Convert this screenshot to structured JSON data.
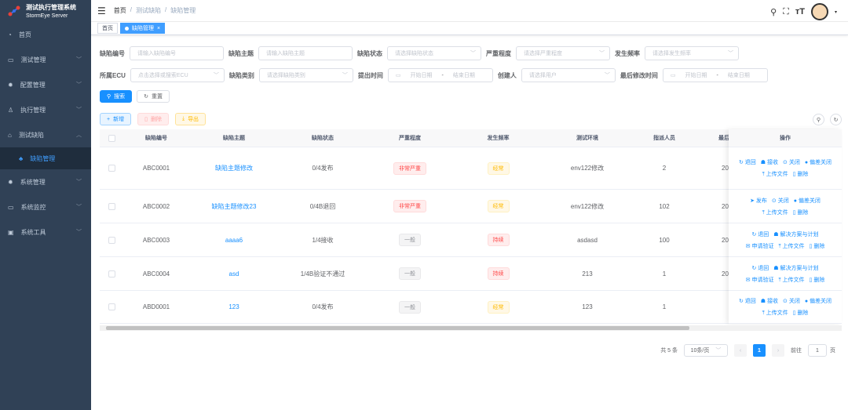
{
  "app": {
    "title": "测试执行管理系统",
    "subtitle": "StormEye Server"
  },
  "sidebar": {
    "items": [
      {
        "label": "首页",
        "icon": "dashboard-icon"
      },
      {
        "label": "测试管理",
        "icon": "monitor-icon",
        "arrow": "﹀"
      },
      {
        "label": "配置管理",
        "icon": "gear-icon",
        "arrow": "﹀"
      },
      {
        "label": "执行管理",
        "icon": "person-icon",
        "arrow": "﹀"
      },
      {
        "label": "测试缺陷",
        "icon": "bug-icon",
        "arrow": "︿"
      },
      {
        "label": "缺陷管理",
        "icon": "tree-icon"
      },
      {
        "label": "系统管理",
        "icon": "gear-icon",
        "arrow": "﹀"
      },
      {
        "label": "系统监控",
        "icon": "monitor-icon",
        "arrow": "﹀"
      },
      {
        "label": "系统工具",
        "icon": "toolbox-icon",
        "arrow": "﹀"
      }
    ]
  },
  "breadcrumb": [
    "首页",
    "测试缺陷",
    "缺陷管理"
  ],
  "tags": [
    {
      "label": "首页"
    },
    {
      "label": "缺陷管理",
      "close": "×"
    }
  ],
  "form": {
    "defect_no": {
      "label": "缺陷编号",
      "placeholder": "请输入缺陷编号"
    },
    "subject": {
      "label": "缺陷主题",
      "placeholder": "请输入缺陷主题"
    },
    "status": {
      "label": "缺陷状态",
      "placeholder": "请选择缺陷状态"
    },
    "severity": {
      "label": "严重程度",
      "placeholder": "请选择严重程度"
    },
    "frequency": {
      "label": "发生频率",
      "placeholder": "请选择发生频率"
    },
    "ecu": {
      "label": "所属ECU",
      "placeholder": "点击选择或搜索ECU"
    },
    "category": {
      "label": "缺陷类别",
      "placeholder": "请选择缺陷类别"
    },
    "submit_time": {
      "label": "提出时间",
      "start": "开始日期",
      "sep": "-",
      "end": "结束日期"
    },
    "creator": {
      "label": "创建人",
      "placeholder": "请选择用户"
    },
    "modified_time": {
      "label": "最后修改时间",
      "start": "开始日期",
      "sep": "-",
      "end": "结束日期"
    },
    "search": "搜索",
    "reset": "重置"
  },
  "toolbar": {
    "add": "新增",
    "delete": "删除",
    "export": "导出"
  },
  "table": {
    "headers": [
      "缺陷编号",
      "缺陷主题",
      "缺陷状态",
      "严重程度",
      "发生频率",
      "测试环境",
      "指派人员",
      "最后"
    ],
    "ops_header": "操作",
    "rows": [
      {
        "id": "ABC0001",
        "subject": "缺陷主题修改",
        "status": "0/4发布",
        "severity": "非常严重",
        "sev_type": "danger",
        "freq": "经常",
        "freq_type": "warn",
        "env": "env122修改",
        "assignee": "2",
        "last": "20",
        "ops": [
          [
            "退回",
            "接收",
            "关闭",
            "偏差关闭"
          ],
          [
            "上传文件",
            "删除"
          ]
        ]
      },
      {
        "id": "ABC0002",
        "subject": "缺陷主题修改23",
        "status": "0/4B退回",
        "severity": "非常严重",
        "sev_type": "danger",
        "freq": "经常",
        "freq_type": "warn",
        "env": "env122修改",
        "assignee": "102",
        "last": "20",
        "ops": [
          [
            "发布",
            "关闭",
            "偏差关闭"
          ],
          [
            "上传文件",
            "删除"
          ]
        ]
      },
      {
        "id": "ABC0003",
        "subject": "aaaa6",
        "status": "1/4接收",
        "severity": "一般",
        "sev_type": "info",
        "freq": "持续",
        "freq_type": "danger",
        "env": "asdasd",
        "assignee": "100",
        "last": "20",
        "ops": [
          [
            "退回",
            "解决方案与计划"
          ],
          [
            "申请验证",
            "上传文件",
            "删除"
          ]
        ]
      },
      {
        "id": "ABC0004",
        "subject": "asd",
        "status": "1/4B验证不通过",
        "severity": "一般",
        "sev_type": "info",
        "freq": "持续",
        "freq_type": "danger",
        "env": "213",
        "assignee": "1",
        "last": "20",
        "ops": [
          [
            "退回",
            "解决方案与计划"
          ],
          [
            "申请验证",
            "上传文件",
            "删除"
          ]
        ]
      },
      {
        "id": "ABD0001",
        "subject": "123",
        "status": "0/4发布",
        "severity": "一般",
        "sev_type": "info",
        "freq": "经常",
        "freq_type": "warn",
        "env": "123",
        "assignee": "1",
        "last": "",
        "ops": [
          [
            "退回",
            "接收",
            "关闭",
            "偏差关闭"
          ],
          [
            "上传文件",
            "删除"
          ]
        ]
      }
    ]
  },
  "pagination": {
    "total": "共 5 条",
    "page_size": "10条/页",
    "current": "1",
    "goto_label": "前往",
    "goto_value": "1",
    "page_suffix": "页"
  },
  "colors": {
    "sidebar": "#304156",
    "primary": "#1890ff"
  }
}
